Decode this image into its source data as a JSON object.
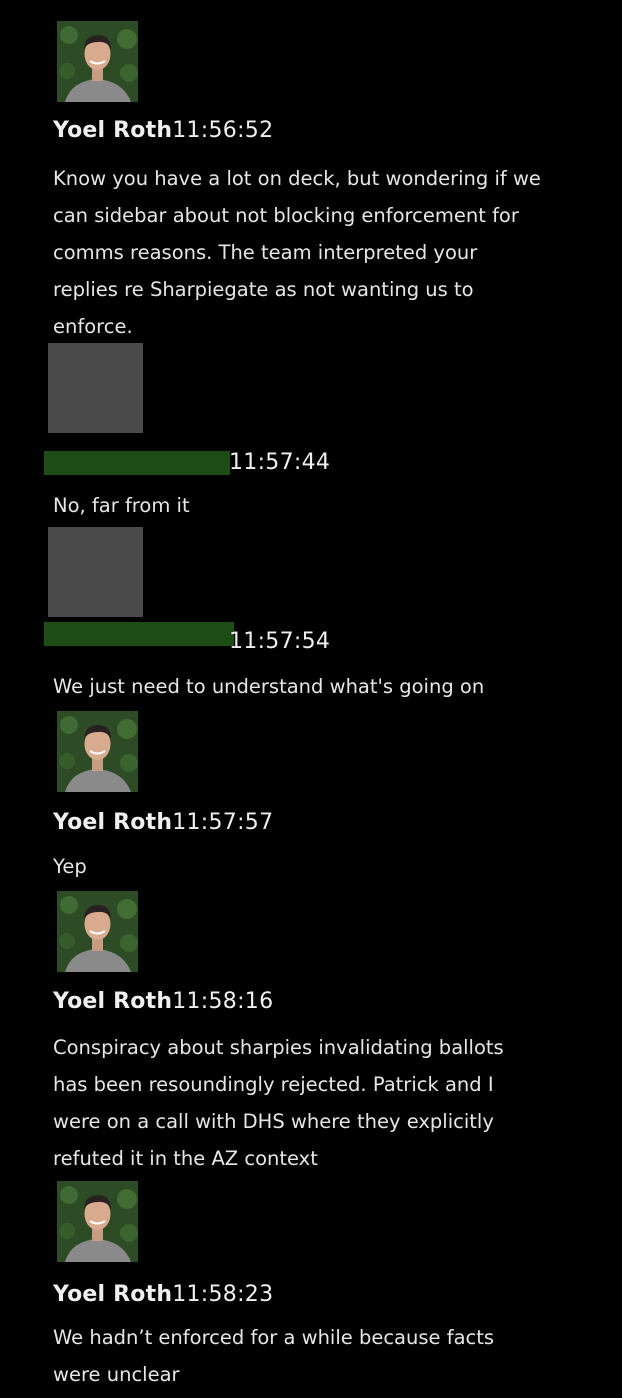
{
  "messages": [
    {
      "author": "Yoel Roth",
      "time": "11:56:52",
      "text": "Know you have a lot on deck, but wondering if we\ncan sidebar about not blocking enforcement for\ncomms reasons. The team interpreted your\nreplies re Sharpiegate as not wanting us to\nenforce.",
      "avatar": "profile-photo"
    },
    {
      "author": "",
      "time": "11:57:44",
      "text": "No, far from it",
      "avatar": "blank-placeholder"
    },
    {
      "author": "",
      "time": "11:57:54",
      "text": "We just need to understand what's going on",
      "avatar": "blank-placeholder"
    },
    {
      "author": "Yoel Roth",
      "time": "11:57:57",
      "text": "Yep",
      "avatar": "profile-photo"
    },
    {
      "author": "Yoel Roth",
      "time": "11:58:16",
      "text": "Conspiracy about sharpies invalidating ballots\nhas been resoundingly rejected. Patrick and I\nwere on a call with DHS where they explicitly\nrefuted it in the AZ context",
      "avatar": "profile-photo"
    },
    {
      "author": "Yoel Roth",
      "time": "11:58:23",
      "text": "We hadn’t enforced for a while because facts\nwere unclear",
      "avatar": "profile-photo"
    }
  ],
  "colors": {
    "background": "#000000",
    "text": "#e6e6e6",
    "redaction": "#1c4d14",
    "placeholder_avatar": "#4a4a4a"
  }
}
